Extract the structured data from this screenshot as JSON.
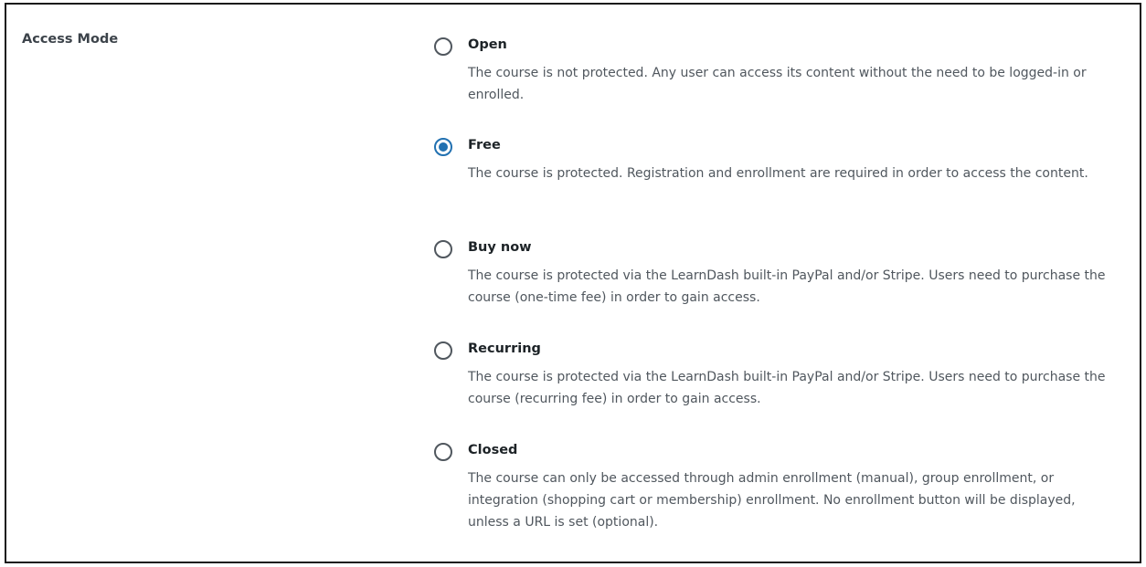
{
  "field": {
    "label": "Access Mode"
  },
  "options": [
    {
      "title": "Open",
      "description": "The course is not protected. Any user can access its content without the need to be logged-in or enrolled.",
      "checked": false
    },
    {
      "title": "Free",
      "description": "The course is protected. Registration and enrollment are required in order to access the content.",
      "checked": true
    },
    {
      "title": "Buy now",
      "description": "The course is protected via the LearnDash built-in PayPal and/or Stripe. Users need to purchase the course (one-time fee) in order to gain access.",
      "checked": false
    },
    {
      "title": "Recurring",
      "description": "The course is protected via the LearnDash built-in PayPal and/or Stripe. Users need to purchase the course (recurring fee) in order to gain access.",
      "checked": false
    },
    {
      "title": "Closed",
      "description": "The course can only be accessed through admin enrollment (manual), group enrollment, or integration (shopping cart or membership) enrollment. No enrollment button will be displayed, unless a URL is set (optional).",
      "checked": false
    }
  ],
  "colors": {
    "accent": "#2271b1",
    "text": "#3c434a",
    "description": "#50575e"
  }
}
